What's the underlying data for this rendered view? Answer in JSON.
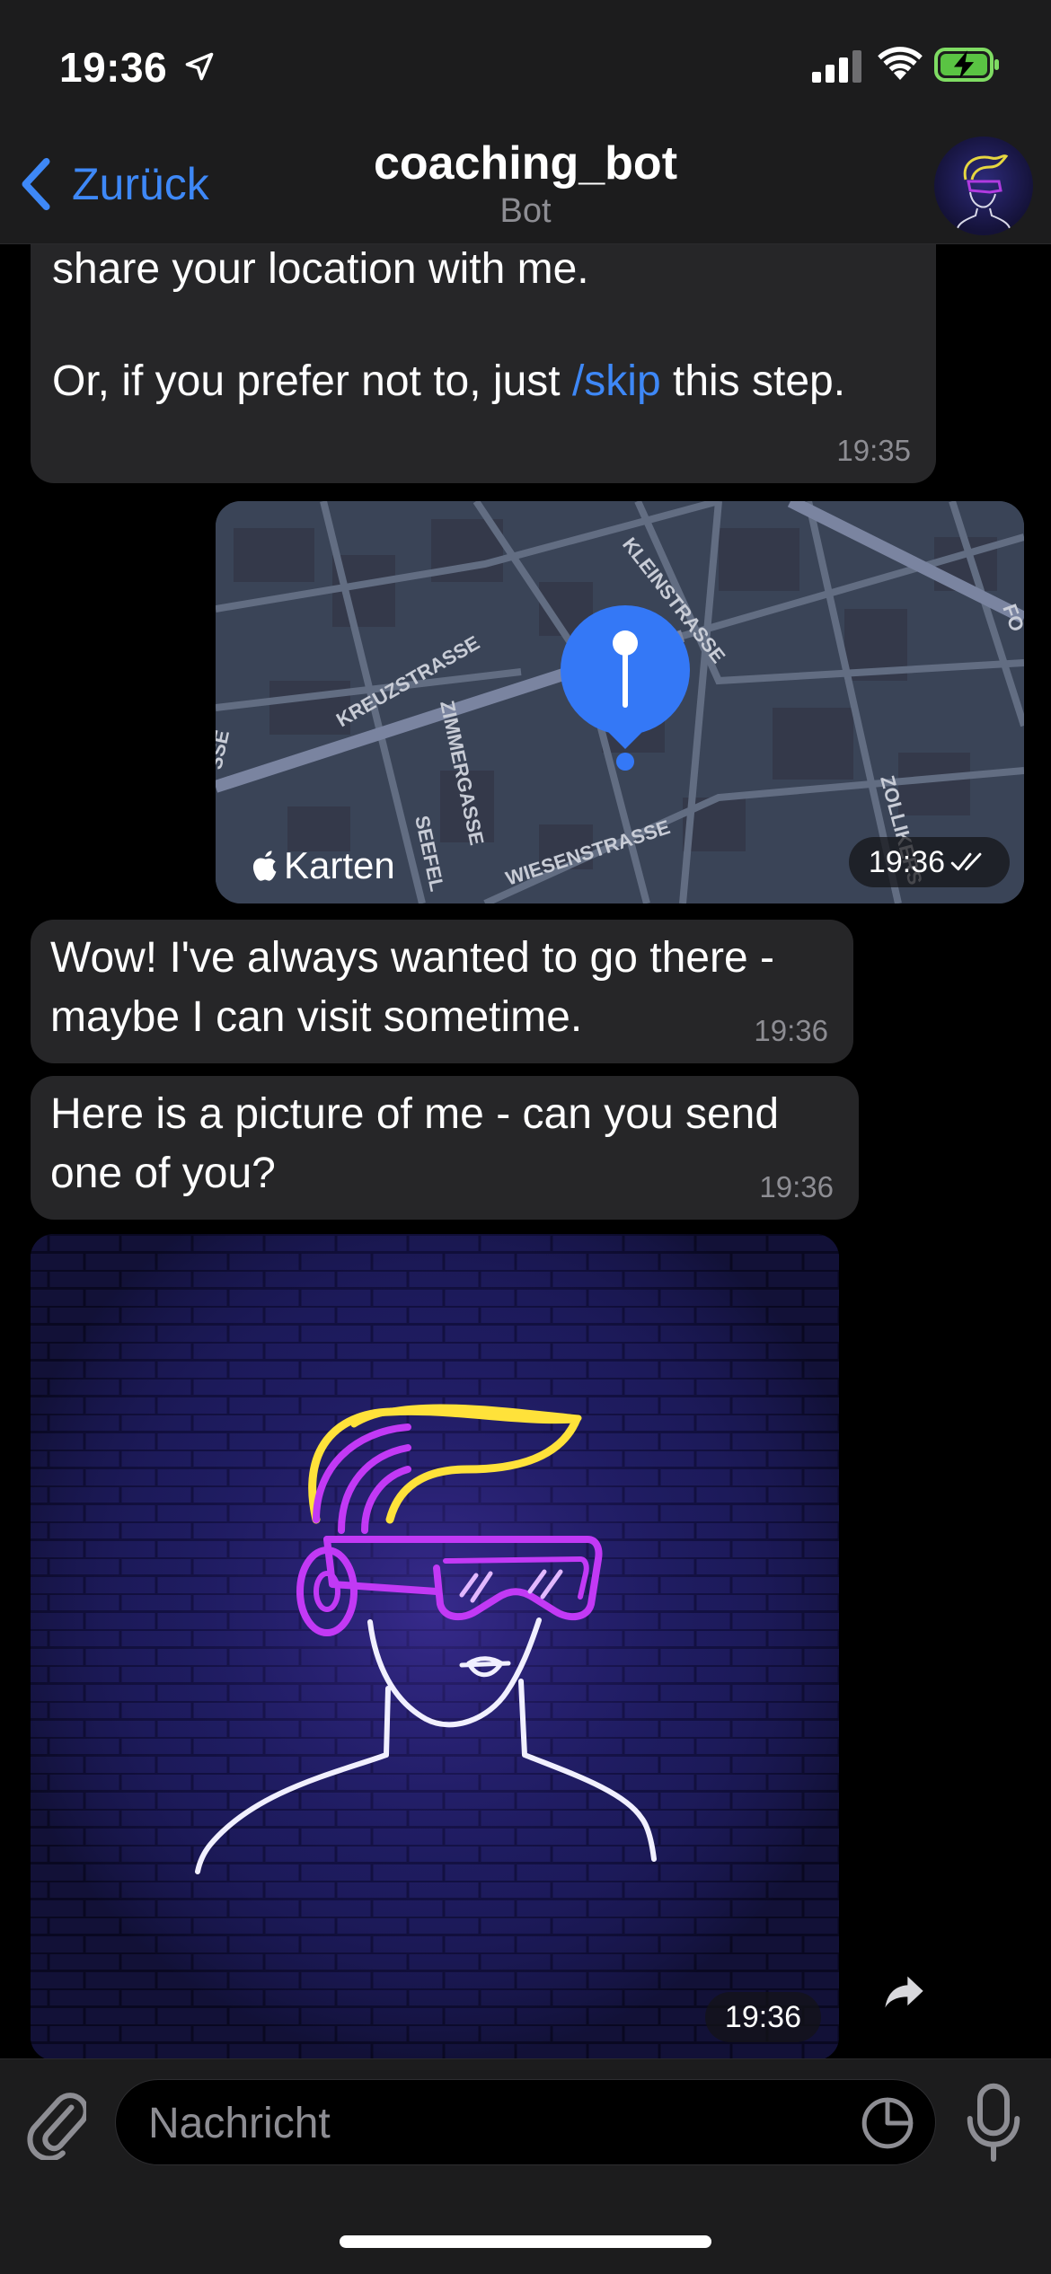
{
  "status_bar": {
    "time": "19:36"
  },
  "header": {
    "back_label": "Zurück",
    "title": "coaching_bot",
    "subtitle": "Bot"
  },
  "messages": [
    {
      "line1": "share your location with me.",
      "line2_pre": "Or, if you prefer not to, just ",
      "line2_link": "/skip",
      "line2_post": " this step.",
      "time": "19:35"
    },
    {
      "type": "location",
      "map_brand": "Karten",
      "time": "19:36",
      "streets": [
        "KREUZSTRASSE",
        "KLEINSTRASSE",
        "ZIMMERGASSE",
        "WIESENSTRASSE",
        "SEEFEL",
        "ZOLLIKERS",
        "SSE",
        "FO"
      ]
    },
    {
      "line1": "Wow! I've always wanted to go there -",
      "line2": "maybe I can visit sometime.",
      "time": "19:36"
    },
    {
      "line1": "Here is a picture of me - can you send",
      "line2": "one of you?",
      "time": "19:36"
    },
    {
      "type": "photo",
      "time": "19:36"
    }
  ],
  "input": {
    "placeholder": "Nachricht"
  },
  "colors": {
    "accent": "#3e88f7",
    "bubble": "#262628",
    "bar": "#1c1c1d",
    "neon_yellow": "#ffe23a",
    "neon_purple": "#c239f5"
  }
}
